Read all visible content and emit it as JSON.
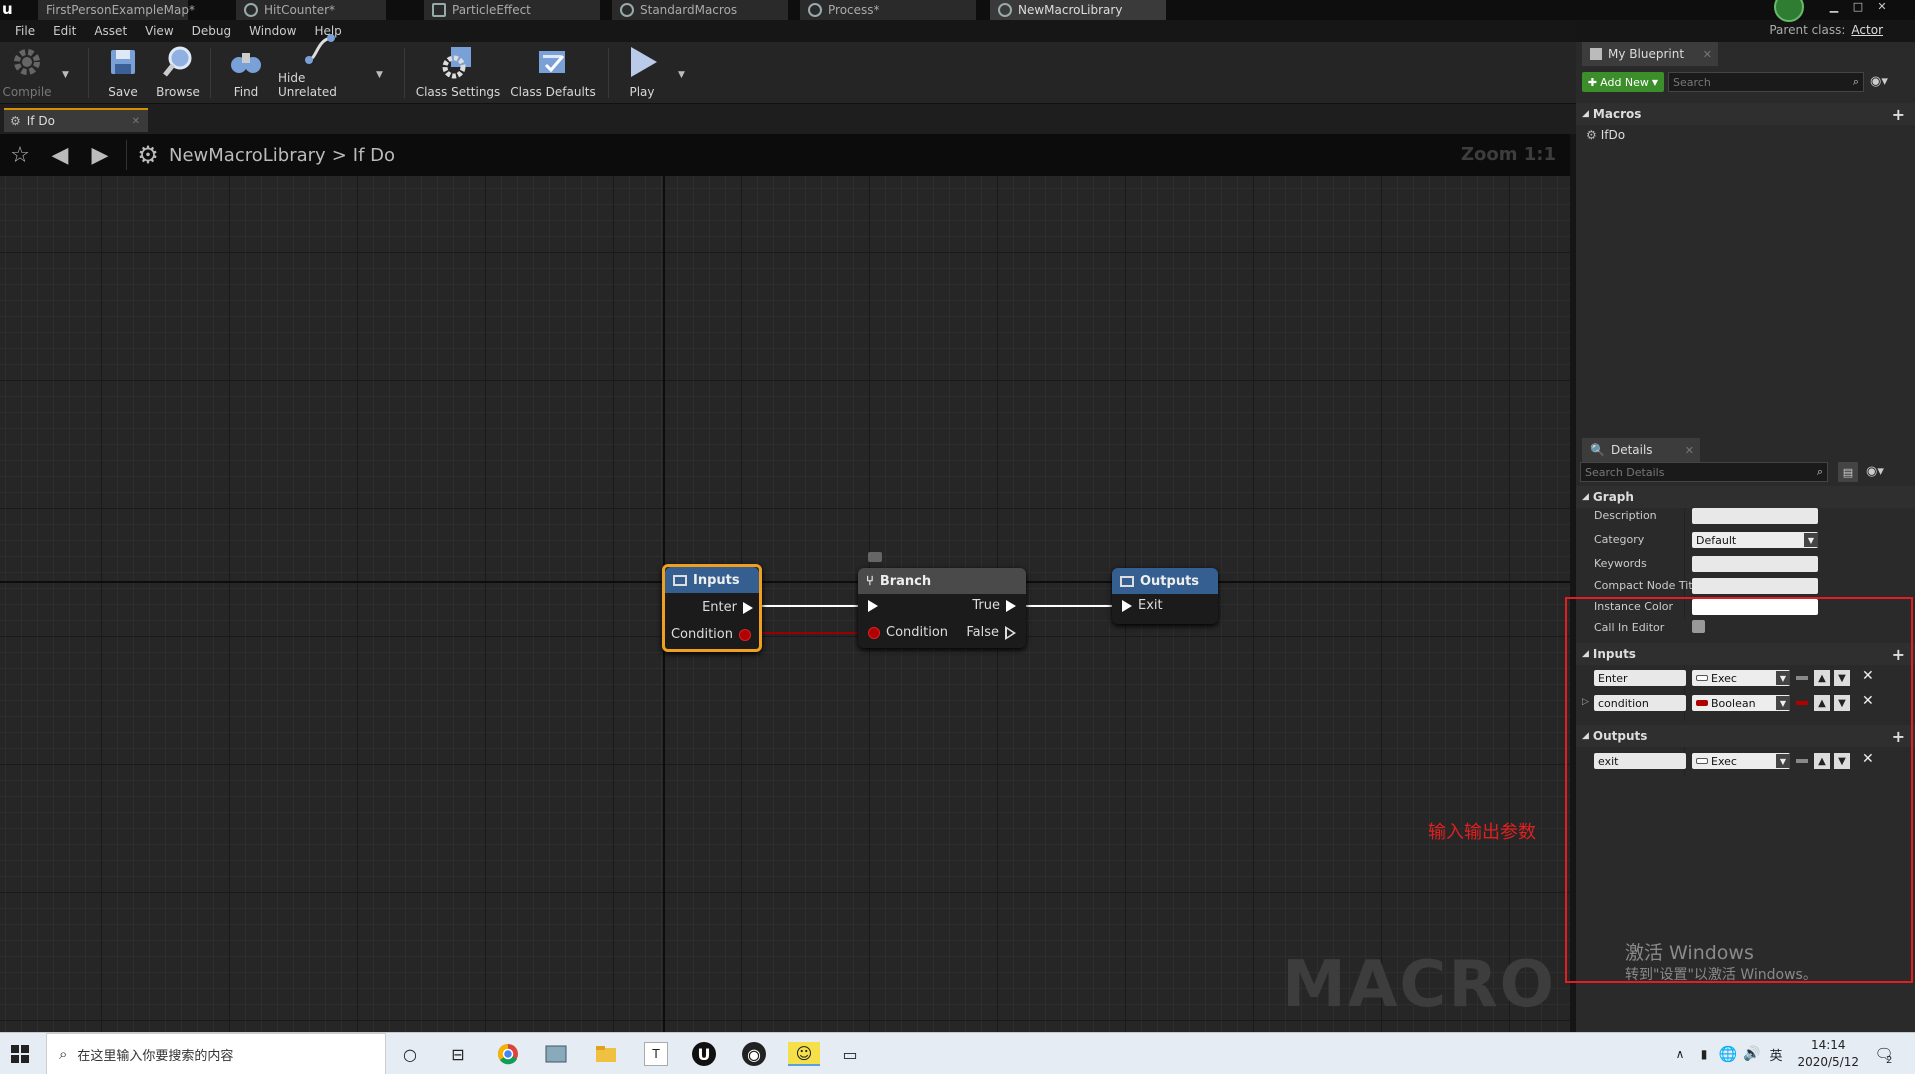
{
  "tabs": [
    {
      "label": "FirstPersonExampleMap*"
    },
    {
      "label": "HitCounter*"
    },
    {
      "label": "ParticleEffect"
    },
    {
      "label": "StandardMacros"
    },
    {
      "label": "Process*"
    },
    {
      "label": "NewMacroLibrary"
    }
  ],
  "menu": [
    "File",
    "Edit",
    "Asset",
    "View",
    "Debug",
    "Window",
    "Help"
  ],
  "parent_class": {
    "label": "Parent class:",
    "value": "Actor"
  },
  "toolbar": {
    "compile": "Compile",
    "save": "Save",
    "browse": "Browse",
    "find": "Find",
    "hide_unrelated": "Hide Unrelated",
    "class_settings": "Class Settings",
    "class_defaults": "Class Defaults",
    "play": "Play"
  },
  "graph_tab": "If Do",
  "breadcrumb": {
    "library": "NewMacroLibrary",
    "separator": ">",
    "graph": "If Do"
  },
  "zoom": "Zoom 1:1",
  "watermark": "MACRO",
  "nodes": {
    "inputs": {
      "title": "Inputs",
      "pin_enter": "Enter",
      "pin_condition": "Condition"
    },
    "branch": {
      "title": "Branch",
      "pin_condition": "Condition",
      "pin_true": "True",
      "pin_false": "False"
    },
    "outputs": {
      "title": "Outputs",
      "pin_exit": "Exit"
    }
  },
  "my_blueprint": {
    "tab": "My Blueprint",
    "add_new": "Add New",
    "search_placeholder": "Search",
    "section": "Macros",
    "items": [
      "IfDo"
    ]
  },
  "details": {
    "tab": "Details",
    "search_placeholder": "Search Details",
    "graph_section": "Graph",
    "props": {
      "description": "Description",
      "category": "Category",
      "category_value": "Default",
      "keywords": "Keywords",
      "compact": "Compact Node Titl",
      "instance_color": "Instance Color",
      "call_in_editor": "Call In Editor"
    },
    "inputs_section": "Inputs",
    "inputs": [
      {
        "name": "Enter",
        "type": "Exec"
      },
      {
        "name": "condition",
        "type": "Boolean"
      }
    ],
    "outputs_section": "Outputs",
    "outputs": [
      {
        "name": "exit",
        "type": "Exec"
      }
    ]
  },
  "annotation": "输入输出参数",
  "activation": {
    "line1": "激活 Windows",
    "line2": "转到\"设置\"以激活 Windows。"
  },
  "taskbar": {
    "search_placeholder": "在这里输入你要搜索的内容",
    "ime": "英",
    "time": "14:14",
    "date": "2020/5/12",
    "notif_count": "2"
  },
  "colors": {
    "exec": "#ffffff",
    "bool": "#b00000",
    "accent_orange": "#f0a020",
    "annotation_red": "#e02020",
    "add_new_green": "#3b8e2a"
  }
}
